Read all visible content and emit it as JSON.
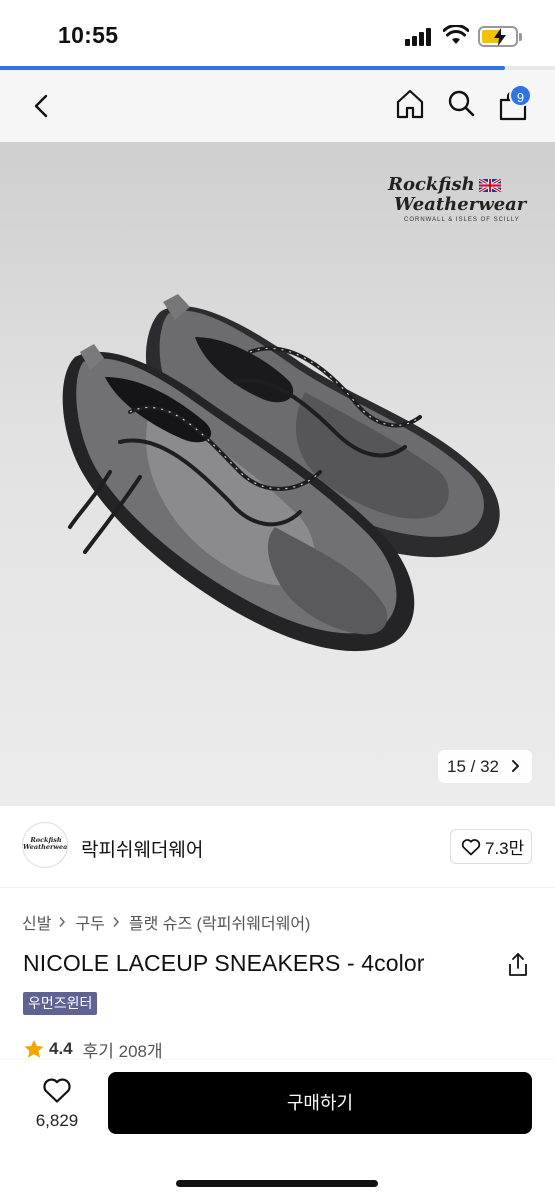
{
  "status_bar": {
    "time": "10:55",
    "battery_level": 0.55
  },
  "page_progress": 0.91,
  "header": {
    "cart_count": "9",
    "accent": "#2d74e8"
  },
  "product_image": {
    "brand_mark_line1": "Rockfish",
    "brand_mark_line2": "Weatherwear",
    "brand_mark_sub": "CORNWALL & ISLES OF SCILLY",
    "counter_text": "15 / 32"
  },
  "brand": {
    "logo_line1": "Rockfish",
    "logo_line2": "Weatherwear",
    "name": "락피쉬웨더웨어",
    "likes": "7.3만"
  },
  "breadcrumb": [
    "신발",
    "구두",
    "플랫 슈즈 (락피쉬웨더웨어)"
  ],
  "product": {
    "title": "NICOLE LACEUP SNEAKERS - 4color",
    "tag": "우먼즈윈터",
    "tag_color": "#5f6292",
    "rating": "4.4",
    "reviews": "후기 208개",
    "star_color": "#f2a400"
  },
  "bottom_bar": {
    "wish_count": "6,829",
    "buy_label": "구매하기"
  },
  "icons": [
    "back-icon",
    "home-icon",
    "search-icon",
    "cart-icon",
    "heart-icon",
    "share-icon",
    "star-icon",
    "chevron-right-icon"
  ]
}
